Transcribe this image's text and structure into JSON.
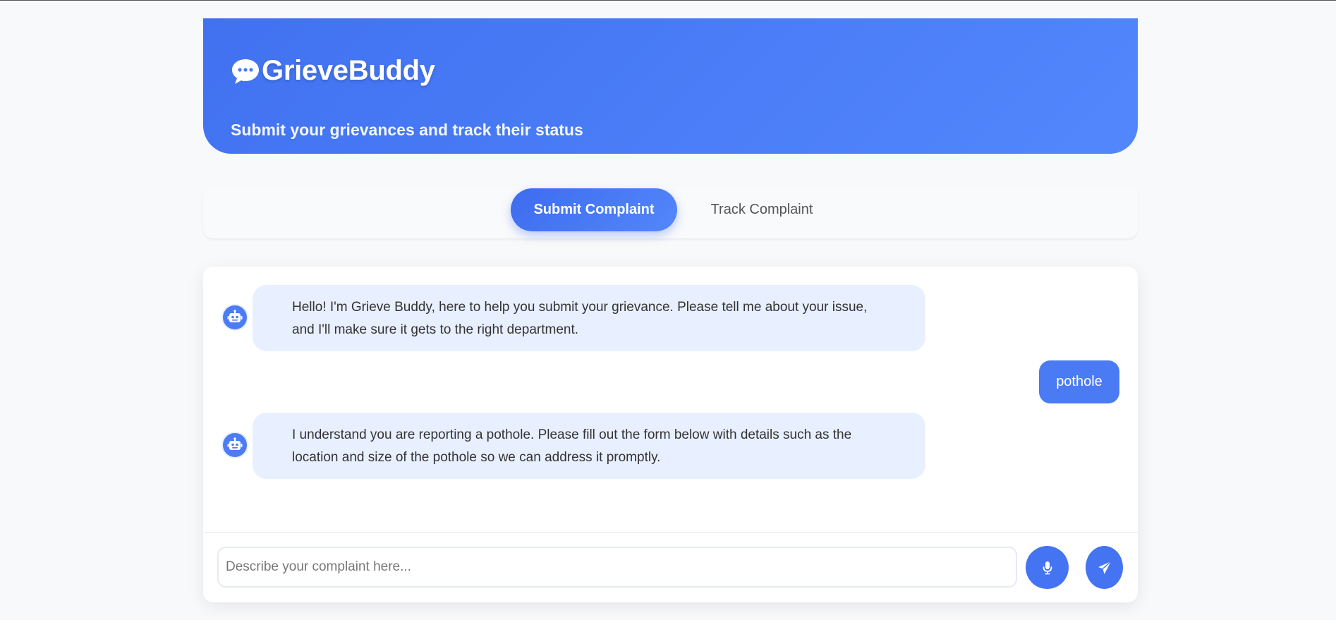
{
  "app": {
    "title": "GrieveBuddy",
    "tagline": "Submit your grievances and track their status",
    "brand_icon": "speech-bubble-icon"
  },
  "tabs": [
    {
      "label": "Submit Complaint",
      "active": true
    },
    {
      "label": "Track Complaint",
      "active": false
    }
  ],
  "messages": [
    {
      "from": "bot",
      "icon": "robot-icon",
      "text_lines": [
        "Hello! I'm Grieve Buddy, here to help you submit your grievance. Please tell me about your issue,",
        "and I'll make sure it gets to the right department."
      ]
    },
    {
      "from": "user",
      "text": "pothole"
    },
    {
      "from": "bot",
      "icon": "robot-icon",
      "text_lines": [
        "I understand you are reporting a pothole. Please fill out the form below with details such as the",
        "location and size of the pothole so we can address it promptly."
      ]
    }
  ],
  "composer": {
    "placeholder": "Describe your complaint here...",
    "value": "",
    "mic_icon": "microphone-icon",
    "send_icon": "paper-plane-icon"
  },
  "colors": {
    "primary": "#4171f0",
    "bot_bubble": "#e8effe",
    "user_bubble": "#4a7bf5",
    "background": "#f8f9fa"
  }
}
